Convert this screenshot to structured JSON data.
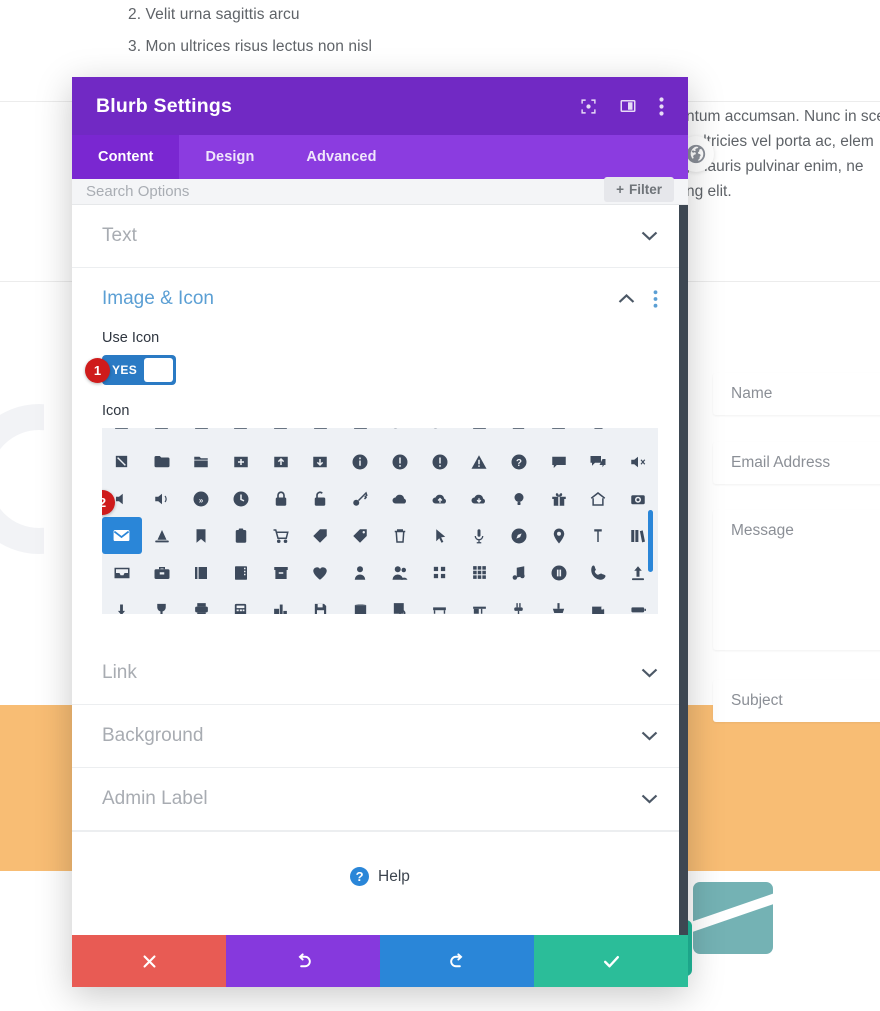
{
  "background": {
    "list_items": [
      "2. Velit urna sagittis arcu",
      "3. Mon ultrices risus lectus non nisl"
    ],
    "paragraph_lines": [
      "ntum accumsan. Nunc in scele",
      ". ultricies vel porta ac, elem",
      ", mauris pulvinar enim, ne",
      "ng elit."
    ],
    "globe_icon": "globe-icon",
    "form_fields": [
      {
        "name": "name-field",
        "placeholder": "Name"
      },
      {
        "name": "email-field",
        "placeholder": "Email Address"
      },
      {
        "name": "message-field",
        "placeholder": "Message"
      },
      {
        "name": "subject-field",
        "placeholder": "Subject"
      }
    ],
    "colors": {
      "orange_band": "#f8bd74",
      "teal_card": "#74b2b4",
      "teal_square": "#21b89a",
      "dark_bar": "#3d4752"
    }
  },
  "modal": {
    "title": "Blurb Settings",
    "header_icons": [
      {
        "name": "focus-mode-icon",
        "label": "focus"
      },
      {
        "name": "layout-panel-icon",
        "label": "layout"
      },
      {
        "name": "kebab-menu-icon",
        "label": "more"
      }
    ],
    "tabs": [
      {
        "label": "Content",
        "active": true
      },
      {
        "label": "Design",
        "active": false
      },
      {
        "label": "Advanced",
        "active": false
      }
    ],
    "search": {
      "placeholder": "Search Options",
      "filter_label": "Filter",
      "filter_icon": "plus-icon"
    },
    "sections": [
      {
        "label": "Text",
        "state": "collapsed"
      },
      {
        "label": "Image & Icon",
        "state": "expanded"
      },
      {
        "label": "Link",
        "state": "collapsed"
      },
      {
        "label": "Background",
        "state": "collapsed"
      },
      {
        "label": "Admin Label",
        "state": "collapsed"
      }
    ],
    "image_icon_section": {
      "title": "Image & Icon",
      "use_icon": {
        "label": "Use Icon",
        "toggle_value": "YES",
        "badge": "1"
      },
      "icon_picker": {
        "label": "Icon",
        "badge": "2",
        "selected_icon": "envelope-icon",
        "rows": [
          [
            "cloud-partial",
            "cloud-partial",
            "cloud-partial",
            "cloud-partial",
            "cloud-partial",
            "cloud-partial",
            "cloud-partial",
            "slash-partial",
            "slash-partial",
            "cloud-partial",
            "bar-partial",
            "cloud-partial",
            "tray-partial",
            "tray-partial"
          ],
          [
            "expand-arrow-icon",
            "folder-icon",
            "folder-open-icon",
            "folder-plus-icon",
            "folder-up-icon",
            "folder-down-icon",
            "info-circle-icon",
            "exclamation-circle-icon",
            "exclamation-circle-alt-icon",
            "warning-triangle-icon",
            "question-circle-icon",
            "comment-icon",
            "comments-icon",
            "volume-mute-icon"
          ],
          [
            "volume-low-icon",
            "volume-high-icon",
            "rewind-icon",
            "clock-icon",
            "lock-icon",
            "unlock-icon",
            "key-icon",
            "cloud-icon",
            "cloud-up-icon",
            "cloud-down-icon",
            "lightbulb-icon",
            "gift-icon",
            "home-icon",
            "camera-icon"
          ],
          [
            "envelope-icon",
            "cone-icon",
            "bookmark-icon",
            "clipboard-icon",
            "cart-icon",
            "tag-icon",
            "tag-outline-icon",
            "trash-icon",
            "cursor-icon",
            "microphone-icon",
            "compass-icon",
            "map-pin-icon",
            "pin-icon",
            "books-icon"
          ],
          [
            "inbox-icon",
            "briefcase-icon",
            "book-icon",
            "contact-card-icon",
            "archive-icon",
            "heart-icon",
            "user-icon",
            "users-icon",
            "grid-4-icon",
            "grid-9-icon",
            "music-note-icon",
            "pause-circle-icon",
            "phone-icon",
            "upload-icon"
          ],
          [
            "download-icon",
            "trophy-icon",
            "printer-icon",
            "calculator-icon",
            "buildings-icon",
            "floppy-icon",
            "book-closed-icon",
            "document-search-icon",
            "bench-icon",
            "desk-icon",
            "plug-icon",
            "tool-icon",
            "bag-icon",
            "battery-icon"
          ]
        ]
      }
    },
    "help": {
      "label": "Help",
      "icon": "question-circle-icon"
    },
    "footer_buttons": [
      {
        "name": "cancel-button",
        "icon": "close-icon",
        "color": "#e85b54"
      },
      {
        "name": "undo-button",
        "icon": "undo-icon",
        "color": "#8639dd"
      },
      {
        "name": "redo-button",
        "icon": "redo-icon",
        "color": "#2a86d8"
      },
      {
        "name": "save-button",
        "icon": "check-icon",
        "color": "#2bbd99"
      }
    ]
  }
}
